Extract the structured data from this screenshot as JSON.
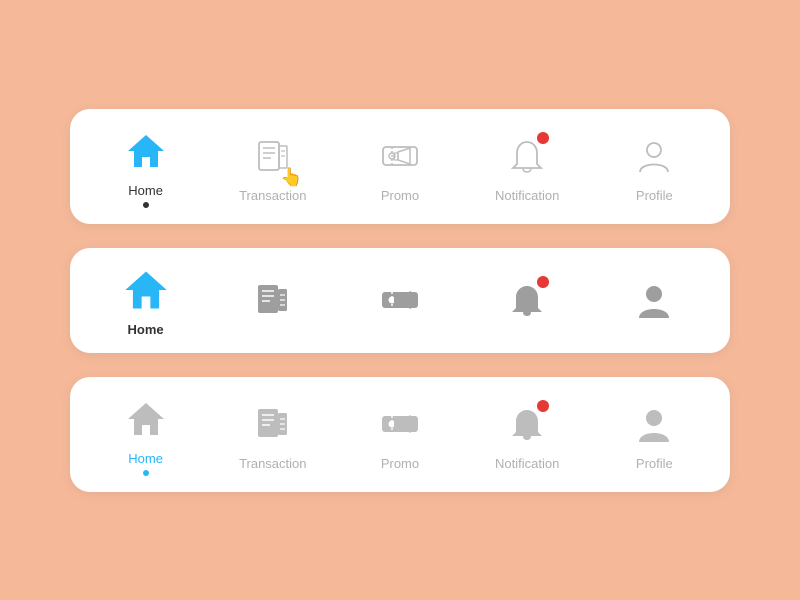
{
  "colors": {
    "background": "#f5b99a",
    "navbar_bg": "#ffffff",
    "active_blue": "#29b6f6",
    "gray_dark": "#9e9e9e",
    "gray_light": "#bdbdbd",
    "badge_red": "#e53935",
    "text_dark": "#333333"
  },
  "navbars": [
    {
      "id": "navbar-1",
      "description": "Active Home with cursor on Transaction",
      "items": [
        {
          "id": "home",
          "label": "Home",
          "active": true,
          "style": "blue-filled",
          "has_dot": true,
          "dot_color": "dark"
        },
        {
          "id": "transaction",
          "label": "Transaction",
          "active": false,
          "style": "outline-gray",
          "has_cursor": true
        },
        {
          "id": "promo",
          "label": "Promo",
          "active": false,
          "style": "gray"
        },
        {
          "id": "notification",
          "label": "Notification",
          "active": false,
          "style": "gray",
          "has_badge": true
        },
        {
          "id": "profile",
          "label": "Profile",
          "active": false,
          "style": "outline-gray"
        }
      ]
    },
    {
      "id": "navbar-2",
      "description": "Active Home bold, no labels",
      "items": [
        {
          "id": "home",
          "label": "Home",
          "active": true,
          "style": "blue-filled"
        },
        {
          "id": "transaction",
          "label": "",
          "active": false,
          "style": "gray-dark"
        },
        {
          "id": "promo",
          "label": "",
          "active": false,
          "style": "gray-dark"
        },
        {
          "id": "notification",
          "label": "",
          "active": false,
          "style": "gray-dark",
          "has_badge": true
        },
        {
          "id": "profile",
          "label": "",
          "active": false,
          "style": "gray-dark"
        }
      ]
    },
    {
      "id": "navbar-3",
      "description": "Active Home blue text, other labels shown",
      "items": [
        {
          "id": "home",
          "label": "Home",
          "active": true,
          "style": "gray-light",
          "label_color": "blue",
          "has_dot": true,
          "dot_color": "blue"
        },
        {
          "id": "transaction",
          "label": "Transaction",
          "active": false,
          "style": "gray-light"
        },
        {
          "id": "promo",
          "label": "Promo",
          "active": false,
          "style": "gray-light"
        },
        {
          "id": "notification",
          "label": "Notification",
          "active": false,
          "style": "gray-light",
          "has_badge": true
        },
        {
          "id": "profile",
          "label": "Profile",
          "active": false,
          "style": "gray-light"
        }
      ]
    }
  ],
  "labels": {
    "home": "Home",
    "transaction": "Transaction",
    "promo": "Promo",
    "notification": "Notification",
    "profile": "Profile"
  }
}
